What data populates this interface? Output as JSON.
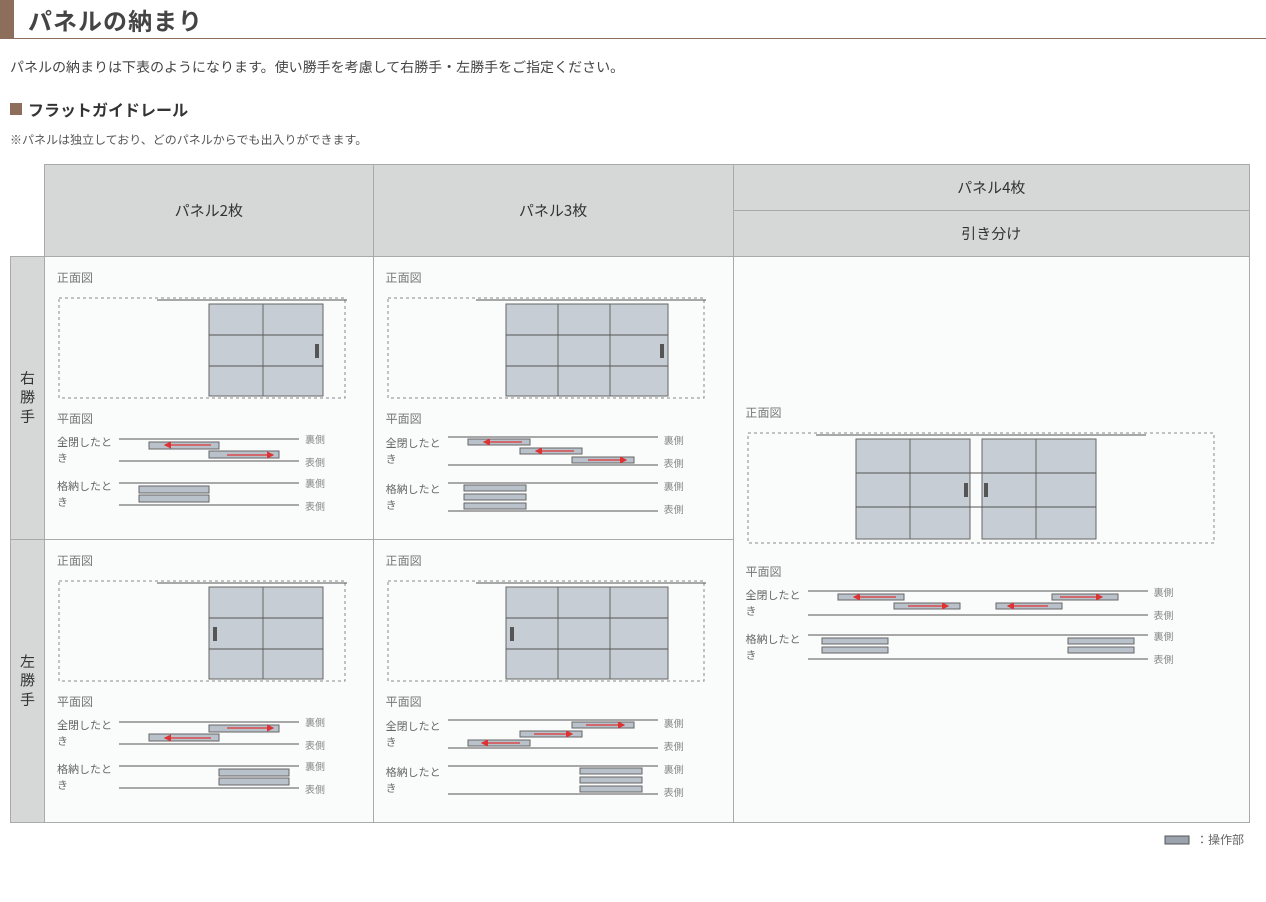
{
  "title": "パネルの納まり",
  "lead": "パネルの納まりは下表のようになります。使い勝手を考慮して右勝手・左勝手をご指定ください。",
  "sub_heading": "フラットガイドレール",
  "note": "※パネルは独立しており、どのパネルからでも出入りができます。",
  "cols": {
    "p2": "パネル2枚",
    "p3": "パネル3枚",
    "p4": "パネル4枚",
    "p4sub": "引き分け"
  },
  "rows": {
    "r": "右勝手",
    "l": "左勝手"
  },
  "labels": {
    "front": "正面図",
    "plan": "平面図",
    "closed": "全閉したとき",
    "stored": "格納したとき",
    "back": "裏側",
    "face": "表側"
  },
  "legend": "：操作部"
}
